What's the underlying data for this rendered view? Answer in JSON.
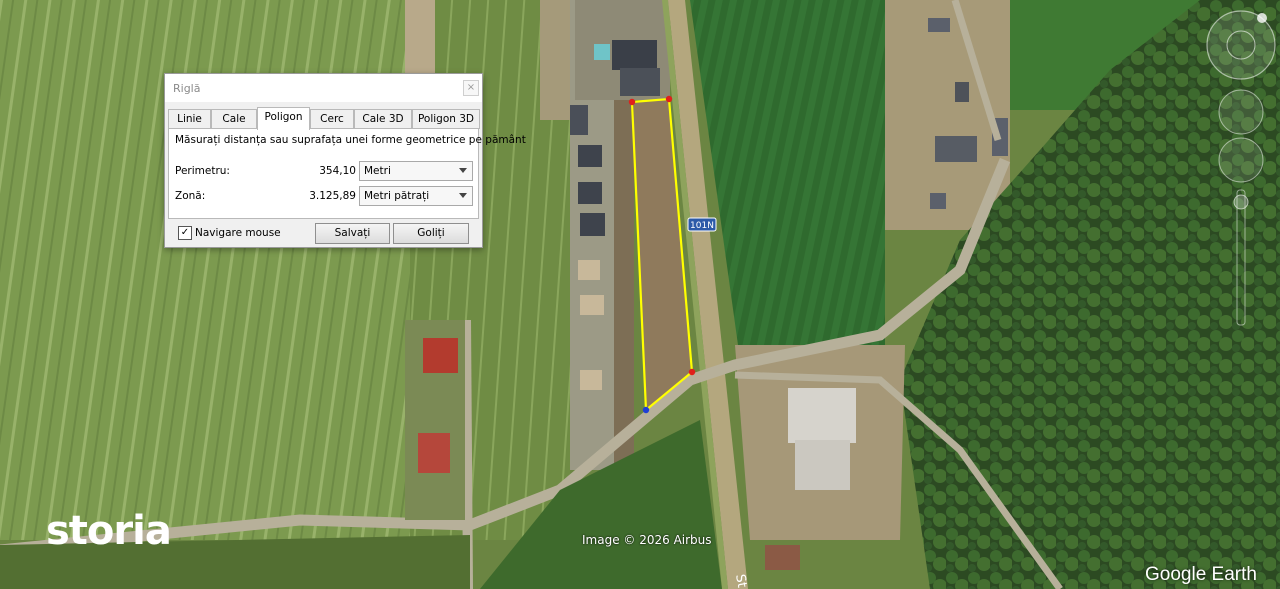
{
  "dialog": {
    "title": "Riglă",
    "close_glyph": "×",
    "tabs": [
      {
        "label": "Linie"
      },
      {
        "label": "Cale"
      },
      {
        "label": "Poligon"
      },
      {
        "label": "Cerc"
      },
      {
        "label": "Cale 3D"
      },
      {
        "label": "Poligon 3D"
      }
    ],
    "active_tab": "Poligon",
    "description": "Măsurați distanța sau suprafața unei forme geometrice pe pământ",
    "perimeter": {
      "label": "Perimetru:",
      "value": "354,10",
      "unit": "Metri"
    },
    "area": {
      "label": "Zonă:",
      "value": "3.125,89",
      "unit": "Metri pătrați"
    },
    "mouse_nav": {
      "label": "Navigare mouse",
      "checked": true,
      "check_glyph": "✓"
    },
    "save_label": "Salvați",
    "clear_label": "Goliți"
  },
  "map": {
    "road_label": "101N",
    "road_text_partial": "St",
    "attribution": "Image © 2026 Airbus",
    "brand": "Google Earth",
    "listing_logo": "storia",
    "polygon_color": "#ffff00",
    "vertex_color_red": "#e0201b",
    "vertex_color_blue": "#1f3fd6"
  }
}
